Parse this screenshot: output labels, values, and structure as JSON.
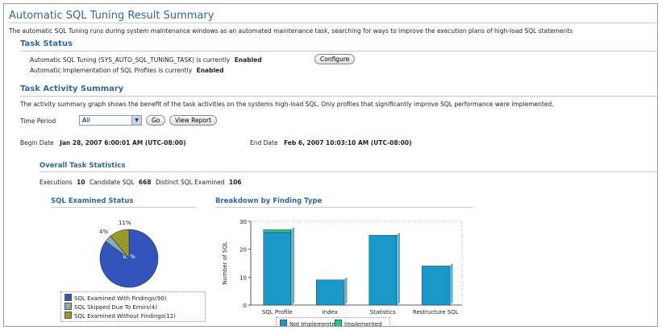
{
  "header": {
    "title": "Automatic SQL Tuning Result Summary",
    "description": "The automatic SQL Tuning runs during system maintenance windows as an automated maintenance task, searching for ways to improve the execution plans of high-load SQL statements"
  },
  "task_status": {
    "heading": "Task Status",
    "line1_prefix": "Automatic SQL Tuning (SYS_AUTO_SQL_TUNING_TASK) is currently",
    "line1_value": "Enabled",
    "configure_label": "Configure",
    "line2_prefix": "Automatic Implementation of SQL Profiles is currently",
    "line2_value": "Enabled"
  },
  "activity": {
    "heading": "Task Activity Summary",
    "description": "The activity summary graph shows the benefit of the task activities on the systems high-load SQL. Only profiles that significantly improve SQL performance were implemented.",
    "time_period_label": "Time Period",
    "time_period_value": "All",
    "go_label": "Go",
    "view_report_label": "View Report",
    "begin_label": "Begin Date",
    "begin_value": "Jan 28, 2007 6:00:01 AM (UTC-08:00)",
    "end_label": "End Date",
    "end_value": "Feb 6, 2007 10:03:10 AM (UTC-08:00)"
  },
  "stats": {
    "heading": "Overall Task Statistics",
    "executions_label": "Executions",
    "executions_value": "10",
    "candidate_label": "Candidate SQL",
    "candidate_value": "668",
    "distinct_label": "Distinct SQL Examined",
    "distinct_value": "106"
  },
  "pie_section": {
    "heading": "SQL Examined Status"
  },
  "bar_section": {
    "heading": "Breakdown by Finding Type"
  },
  "chart_data": [
    {
      "type": "pie",
      "title": "SQL Examined Status",
      "labels": [
        "SQL Examined With Findings(90)",
        "SQL Skipped Due To Errors(4)",
        "SQL Examined Without Findings(12)"
      ],
      "values": [
        85,
        4,
        11
      ],
      "slice_labels": [
        "85%",
        "4%",
        "11%"
      ],
      "colors": [
        "#3355bb",
        "#88aabb",
        "#99992a"
      ]
    },
    {
      "type": "bar",
      "title": "Breakdown by Finding Type",
      "ylabel": "Number of SQL",
      "categories": [
        "SQL Profile",
        "Index",
        "Statistics",
        "Restructure SQL"
      ],
      "series": [
        {
          "name": "Not Implemented",
          "values": [
            26,
            9,
            25,
            14
          ],
          "color": "#1a99c8"
        },
        {
          "name": "Implemented",
          "values": [
            1,
            0,
            0,
            0
          ],
          "color": "#22c88a"
        }
      ],
      "yticks": [
        "0",
        "10",
        "20",
        "30"
      ],
      "ylim": [
        0,
        30
      ],
      "legend": "bottom"
    }
  ]
}
